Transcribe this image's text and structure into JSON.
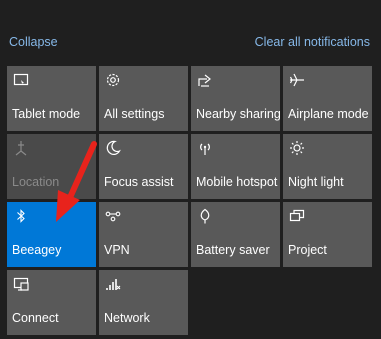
{
  "header": {
    "collapse_label": "Collapse",
    "clear_label": "Clear all notifications"
  },
  "tiles": [
    {
      "label": "Tablet mode",
      "icon": "tablet-mode-icon",
      "state": "off"
    },
    {
      "label": "All settings",
      "icon": "gear-icon",
      "state": "off"
    },
    {
      "label": "Nearby sharing",
      "icon": "share-icon",
      "state": "off"
    },
    {
      "label": "Airplane mode",
      "icon": "airplane-icon",
      "state": "off"
    },
    {
      "label": "Location",
      "icon": "location-icon",
      "state": "disabled"
    },
    {
      "label": "Focus assist",
      "icon": "moon-icon",
      "state": "off"
    },
    {
      "label": "Mobile hotspot",
      "icon": "hotspot-icon",
      "state": "off"
    },
    {
      "label": "Night light",
      "icon": "sun-icon",
      "state": "off"
    },
    {
      "label": "Beeagey",
      "icon": "bluetooth-icon",
      "state": "on"
    },
    {
      "label": "VPN",
      "icon": "vpn-icon",
      "state": "off"
    },
    {
      "label": "Battery saver",
      "icon": "leaf-icon",
      "state": "off"
    },
    {
      "label": "Project",
      "icon": "project-icon",
      "state": "off"
    },
    {
      "label": "Connect",
      "icon": "connect-icon",
      "state": "off"
    },
    {
      "label": "Network",
      "icon": "network-icon",
      "state": "off"
    }
  ],
  "colors": {
    "accent": "#0078d7",
    "tile": "#595959",
    "background": "#1f1f1f",
    "annotation_arrow": "#e8231c"
  }
}
